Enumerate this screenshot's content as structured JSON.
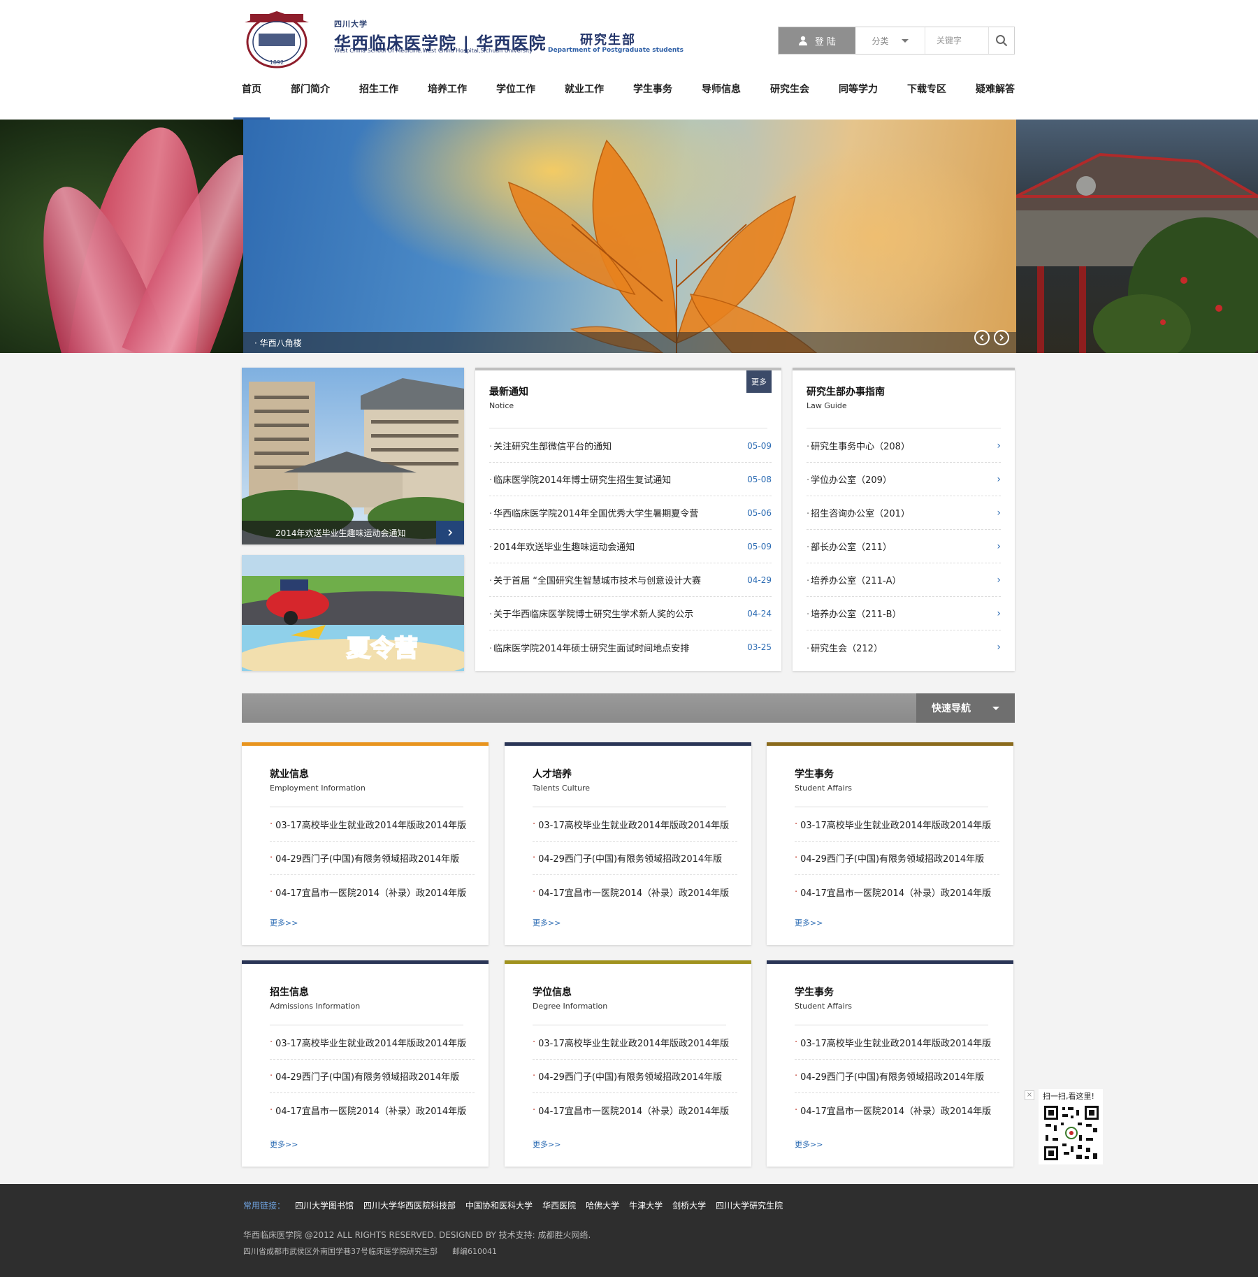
{
  "header": {
    "university_small": "四川大学",
    "school_name": "华西临床医学院 | 华西医院",
    "school_name_en": "West China School Of Medicine.West China Hospital,Sichuan University",
    "dept_name": "研究生部",
    "dept_name_en": "Department of Postgraduate students",
    "seal_year": "1892",
    "login_label": "登 陆",
    "category_label": "分类",
    "keyword_placeholder": "关键字"
  },
  "nav": [
    "首页",
    "部门简介",
    "招生工作",
    "培养工作",
    "学位工作",
    "就业工作",
    "学生事务",
    "导师信息",
    "研究生会",
    "同等学力",
    "下载专区",
    "疑难解答"
  ],
  "banner": {
    "caption": "· 华西八角楼"
  },
  "photo_card": {
    "caption": "2014年欢送毕业生趣味运动会通知"
  },
  "summer_card": {
    "text": "夏令营"
  },
  "notice": {
    "title": "最新通知",
    "subtitle": "Notice",
    "more_label": "更多",
    "items": [
      {
        "text": "关注研究生部微信平台的通知",
        "date": "05-09"
      },
      {
        "text": "临床医学院2014年博士研究生招生复试通知",
        "date": "05-08"
      },
      {
        "text": "华西临床医学院2014年全国优秀大学生暑期夏令营",
        "date": "05-06"
      },
      {
        "text": "2014年欢送毕业生趣味运动会通知",
        "date": "05-09"
      },
      {
        "text": "关于首届 “全国研究生智慧城市技术与创意设计大赛",
        "date": "04-29"
      },
      {
        "text": "关于华西临床医学院博士研究生学术新人奖的公示",
        "date": "04-24"
      },
      {
        "text": "临床医学院2014年硕士研究生面试时间地点安排",
        "date": "03-25"
      }
    ]
  },
  "guide": {
    "title": "研究生部办事指南",
    "subtitle": "Law Guide",
    "items": [
      "研究生事务中心（208）",
      "学位办公室（209）",
      "招生咨询办公室（201）",
      "部长办公室（211）",
      "培养办公室（211-A）",
      "培养办公室（211-B）",
      "研究生会（212）"
    ]
  },
  "quick_nav_label": "快速导航",
  "cards": [
    {
      "title": "就业信息",
      "subtitle": "Employment Information",
      "accent": "#e8941e",
      "items": [
        "03-17高校毕业生就业政2014年版政2014年版",
        "04-29西门子(中国)有限务领域招政2014年版",
        "04-17宜昌市一医院2014（补录）政2014年版"
      ],
      "more": "更多>>"
    },
    {
      "title": "人才培养",
      "subtitle": "Talents Culture",
      "accent": "#2a3556",
      "items": [
        "03-17高校毕业生就业政2014年版政2014年版",
        "04-29西门子(中国)有限务领域招政2014年版",
        "04-17宜昌市一医院2014（补录）政2014年版"
      ],
      "more": "更多>>"
    },
    {
      "title": "学生事务",
      "subtitle": "Student Affairs",
      "accent": "#8a6a1c",
      "items": [
        "03-17高校毕业生就业政2014年版政2014年版",
        "04-29西门子(中国)有限务领域招政2014年版",
        "04-17宜昌市一医院2014（补录）政2014年版"
      ],
      "more": "更多>>"
    },
    {
      "title": "招生信息",
      "subtitle": "Admissions Information",
      "accent": "#2a3556",
      "items": [
        "03-17高校毕业生就业政2014年版政2014年版",
        "04-29西门子(中国)有限务领域招政2014年版",
        "04-17宜昌市一医院2014（补录）政2014年版"
      ],
      "more": "更多>>"
    },
    {
      "title": "学位信息",
      "subtitle": "Degree Information",
      "accent": "#a0921e",
      "items": [
        "03-17高校毕业生就业政2014年版政2014年版",
        "04-29西门子(中国)有限务领域招政2014年版",
        "04-17宜昌市一医院2014（补录）政2014年版"
      ],
      "more": "更多>>"
    },
    {
      "title": "学生事务",
      "subtitle": "Student Affairs",
      "accent": "#2a3556",
      "items": [
        "03-17高校毕业生就业政2014年版政2014年版",
        "04-29西门子(中国)有限务领域招政2014年版",
        "04-17宜昌市一医院2014（补录）政2014年版"
      ],
      "more": "更多>>"
    }
  ],
  "qr": {
    "text": "扫一扫,看这里!"
  },
  "footer": {
    "links_label": "常用链接：",
    "links": [
      "四川大学图书馆",
      "四川大学华西医院科技部",
      "中国协和医科大学",
      "华西医院",
      "哈佛大学",
      "牛津大学",
      "剑桥大学",
      "四川大学研究生院"
    ],
    "copyright": "华西临床医学院 @2012 ALL RIGHTS RESERVED. DESIGNED BY  技术支持: 成都胜火网络.",
    "address": "四川省成都市武侯区外南国学巷37号临床医学院研究生部      邮编610041"
  },
  "colors": {
    "primary": "#23356a",
    "link_blue": "#2e6db4",
    "footer_bg": "#2e2e2e"
  }
}
